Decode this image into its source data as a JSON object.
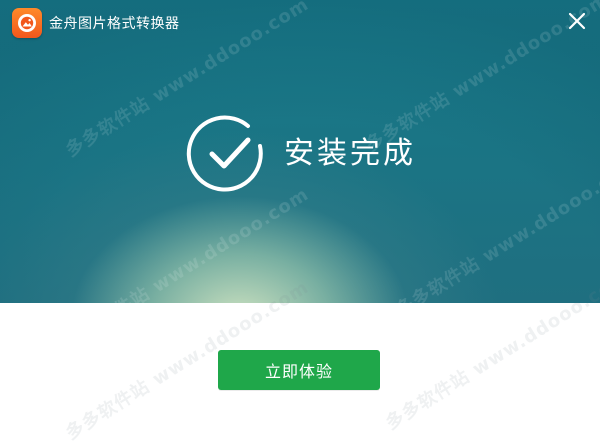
{
  "window": {
    "title": "金舟图片格式转换器"
  },
  "status": {
    "text": "安装完成"
  },
  "actions": {
    "primary_label": "立即体验"
  },
  "watermark": {
    "text": "多多软件站  www.ddooo.com"
  },
  "colors": {
    "hero_top": "#187a8a",
    "hero_glow": "#d6e8c4",
    "primary_button": "#1fa74a",
    "logo_orange": "#f2571c",
    "text_on_hero": "#ffffff"
  },
  "icons": {
    "logo": "app-logo-icon",
    "close": "close-icon",
    "status": "check-circle-icon"
  }
}
